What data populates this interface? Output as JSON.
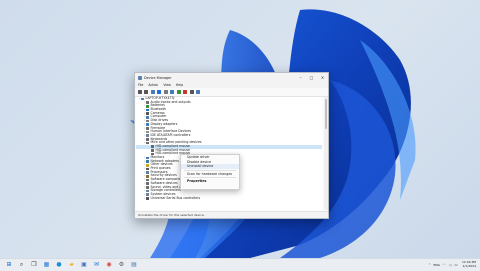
{
  "window": {
    "title": "Device Manager",
    "controls": {
      "minimize": "–",
      "maximize": "□",
      "close": "✕"
    },
    "menu": [
      "File",
      "Action",
      "View",
      "Help"
    ],
    "toolbar_icons": [
      "back-icon",
      "forward-icon",
      "properties-icon",
      "help-icon",
      "show-hidden-icon",
      "monitor-icon",
      "update-driver-icon",
      "uninstall-icon",
      "disable-icon",
      "scan-icon"
    ],
    "tree": [
      {
        "label": "LAPTOP-H7YX4T3J",
        "level": 0,
        "expander": "⌄",
        "icon": "computer-icon",
        "color": "#4a7ab5"
      },
      {
        "label": "Audio inputs and outputs",
        "level": 1,
        "expander": "›",
        "icon": "speaker-icon",
        "color": "#6d6d6d"
      },
      {
        "label": "Batteries",
        "level": 1,
        "expander": "›",
        "icon": "battery-icon",
        "color": "#3a8d3a"
      },
      {
        "label": "Bluetooth",
        "level": 1,
        "expander": "›",
        "icon": "bluetooth-icon",
        "color": "#1f6fd0"
      },
      {
        "label": "Cameras",
        "level": 1,
        "expander": "›",
        "icon": "camera-icon",
        "color": "#555555"
      },
      {
        "label": "Computer",
        "level": 1,
        "expander": "›",
        "icon": "computer-icon",
        "color": "#4a7ab5"
      },
      {
        "label": "Disk drives",
        "level": 1,
        "expander": "›",
        "icon": "disk-icon",
        "color": "#777777"
      },
      {
        "label": "Display adapters",
        "level": 1,
        "expander": "›",
        "icon": "display-icon",
        "color": "#3b7bbf"
      },
      {
        "label": "Firmware",
        "level": 1,
        "expander": "›",
        "icon": "chip-icon",
        "color": "#6b6b6b"
      },
      {
        "label": "Human Interface Devices",
        "level": 1,
        "expander": "›",
        "icon": "hid-icon",
        "color": "#8a8a8a"
      },
      {
        "label": "IDE ATA/ATAPI controllers",
        "level": 1,
        "expander": "›",
        "icon": "controller-icon",
        "color": "#6a7f99"
      },
      {
        "label": "Keyboards",
        "level": 1,
        "expander": "›",
        "icon": "keyboard-icon",
        "color": "#666666"
      },
      {
        "label": "Mice and other pointing devices",
        "level": 1,
        "expander": "⌄",
        "icon": "mouse-icon",
        "color": "#666666"
      },
      {
        "label": "HID-compliant mouse",
        "level": 2,
        "expander": "",
        "icon": "mouse-icon",
        "color": "#666666",
        "selected": true
      },
      {
        "label": "HID-compliant mouse",
        "level": 2,
        "expander": "",
        "icon": "mouse-icon",
        "color": "#666666"
      },
      {
        "label": "HID-compliant mouse",
        "level": 2,
        "expander": "",
        "icon": "mouse-icon",
        "color": "#666666"
      },
      {
        "label": "Monitors",
        "level": 1,
        "expander": "›",
        "icon": "monitor-icon",
        "color": "#3b7bbf"
      },
      {
        "label": "Network adapters",
        "level": 1,
        "expander": "›",
        "icon": "network-icon",
        "color": "#3a7a9c"
      },
      {
        "label": "Other devices",
        "level": 1,
        "expander": "›",
        "icon": "warning-device-icon",
        "color": "#c7a21b"
      },
      {
        "label": "Print queues",
        "level": 1,
        "expander": "›",
        "icon": "printer-icon",
        "color": "#555555"
      },
      {
        "label": "Processors",
        "level": 1,
        "expander": "›",
        "icon": "cpu-icon",
        "color": "#5e7c98"
      },
      {
        "label": "Security devices",
        "level": 1,
        "expander": "›",
        "icon": "security-icon",
        "color": "#8a6d2f"
      },
      {
        "label": "Software components",
        "level": 1,
        "expander": "›",
        "icon": "component-icon",
        "color": "#6b6b6b"
      },
      {
        "label": "Software devices",
        "level": 1,
        "expander": "›",
        "icon": "component-icon",
        "color": "#6b6b6b"
      },
      {
        "label": "Sound, video and game controllers",
        "level": 1,
        "expander": "›",
        "icon": "speaker-icon",
        "color": "#6d6d6d"
      },
      {
        "label": "Storage controllers",
        "level": 1,
        "expander": "›",
        "icon": "storage-icon",
        "color": "#6a7f99"
      },
      {
        "label": "System devices",
        "level": 1,
        "expander": "›",
        "icon": "system-icon",
        "color": "#6a7f99"
      },
      {
        "label": "Universal Serial Bus controllers",
        "level": 1,
        "expander": "›",
        "icon": "usb-icon",
        "color": "#555555"
      }
    ],
    "status": "Uninstalls the driver for the selected device."
  },
  "context_menu": {
    "items": [
      {
        "label": "Update driver",
        "type": "item"
      },
      {
        "label": "Disable device",
        "type": "item"
      },
      {
        "label": "Uninstall device",
        "type": "item",
        "hover": true
      },
      {
        "type": "separator"
      },
      {
        "label": "Scan for hardware changes",
        "type": "item"
      },
      {
        "type": "separator"
      },
      {
        "label": "Properties",
        "type": "item",
        "bold": true
      }
    ]
  },
  "taskbar": {
    "apps": [
      {
        "name": "start-icon",
        "glyph": "⊞",
        "color": "#1f6fd0"
      },
      {
        "name": "search-icon",
        "glyph": "⌕",
        "color": "#333333"
      },
      {
        "name": "task-view-icon",
        "glyph": "❐",
        "color": "#333333"
      },
      {
        "name": "widgets-icon",
        "glyph": "▦",
        "color": "#2d7dd2"
      },
      {
        "name": "edge-icon",
        "glyph": "●",
        "color": "#1e8ed6"
      },
      {
        "name": "file-explorer-icon",
        "glyph": "▰",
        "color": "#e8b53a"
      },
      {
        "name": "store-icon",
        "glyph": "▣",
        "color": "#3c6fcf"
      },
      {
        "name": "mail-icon",
        "glyph": "✉",
        "color": "#1f6fd0"
      },
      {
        "name": "chrome-icon",
        "glyph": "◉",
        "color": "#d9453a"
      },
      {
        "name": "settings-icon",
        "glyph": "⚙",
        "color": "#555555"
      },
      {
        "name": "device-manager-icon",
        "glyph": "▤",
        "color": "#4a7ab5"
      }
    ],
    "tray": {
      "lang": "ENG",
      "time": "12:00 PM",
      "date": "1/1/2024"
    }
  }
}
